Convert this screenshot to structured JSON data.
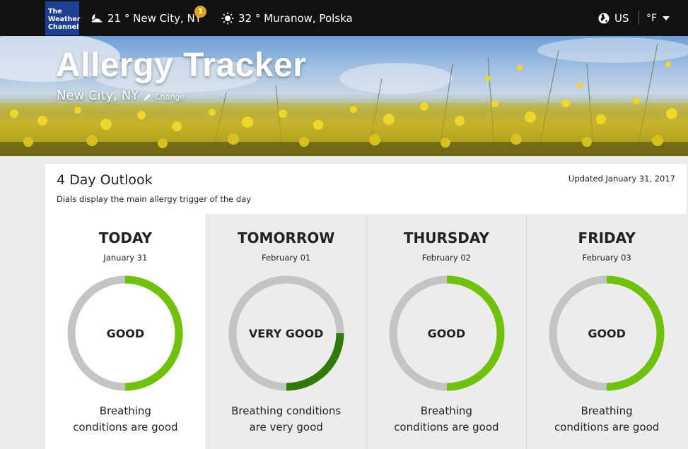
{
  "brand": {
    "logo_lines": [
      "The",
      "Weather",
      "Channel"
    ]
  },
  "topbar": {
    "locations": [
      {
        "temp": "21 °",
        "name": "New City, NY",
        "icon": "partly-cloudy-night-icon",
        "badge": "1"
      },
      {
        "temp": "32 °",
        "name": "Muranow, Polska",
        "icon": "sun-icon"
      }
    ],
    "country": "US",
    "unit": "°F"
  },
  "hero": {
    "title": "Allergy Tracker",
    "city": "New City, NY",
    "change_label": "Change"
  },
  "outlook": {
    "title": "4 Day Outlook",
    "subtitle": "Dials display the main allergy trigger of the day",
    "updated": "Updated January 31, 2017",
    "days": [
      {
        "name": "TODAY",
        "date": "January 31",
        "level": "GOOD",
        "fill": 0.5,
        "desc_lines": [
          "Breathing",
          "conditions are good"
        ]
      },
      {
        "name": "TOMORROW",
        "date": "February 01",
        "level": "VERY GOOD",
        "fill": 0.25,
        "desc_lines": [
          "Breathing conditions",
          "are very good"
        ]
      },
      {
        "name": "THURSDAY",
        "date": "February 02",
        "level": "GOOD",
        "fill": 0.5,
        "desc_lines": [
          "Breathing",
          "conditions are good"
        ]
      },
      {
        "name": "FRIDAY",
        "date": "February 03",
        "level": "GOOD",
        "fill": 0.5,
        "desc_lines": [
          "Breathing",
          "conditions are good"
        ]
      }
    ]
  },
  "colors": {
    "good": "#6fc10a",
    "very_good": "#2f7a0b",
    "track": "#c4c4c4",
    "brand": "#1c3f94",
    "badge": "#e0a21a"
  }
}
